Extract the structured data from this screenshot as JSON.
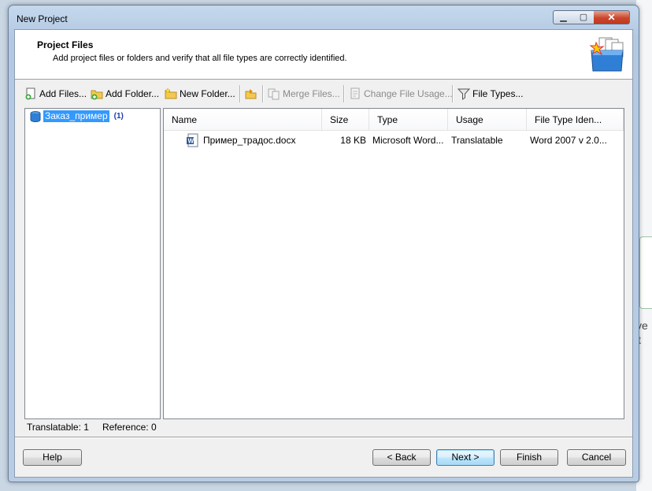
{
  "window": {
    "title": "New Project"
  },
  "header": {
    "title": "Project Files",
    "subtitle": "Add project files or folders and verify that all file types are correctly identified."
  },
  "toolbar": {
    "add_files": "Add Files...",
    "add_folder": "Add Folder...",
    "new_folder": "New Folder...",
    "merge_files": "Merge Files...",
    "change_file_usage": "Change File Usage...",
    "file_types": "File Types..."
  },
  "tree": {
    "root_label": "Заказ_пример",
    "root_count": "(1)"
  },
  "file_list": {
    "columns": [
      "Name",
      "Size",
      "Type",
      "Usage",
      "File Type Iden..."
    ],
    "rows": [
      {
        "name": "Пример_традос.docx",
        "size": "18 KB",
        "type": "Microsoft Word...",
        "usage": "Translatable",
        "file_type": "Word 2007 v 2.0..."
      }
    ]
  },
  "status": {
    "translatable": "Translatable: 1",
    "reference": "Reference: 0"
  },
  "buttons": {
    "help": "Help",
    "back": "< Back",
    "next": "Next >",
    "finish": "Finish",
    "cancel": "Cancel"
  },
  "background": {
    "text1": "ve",
    "text2": "t"
  },
  "colors": {
    "selection": "#3399ff",
    "count": "#1a3db0",
    "close_button": "#c9462c"
  }
}
